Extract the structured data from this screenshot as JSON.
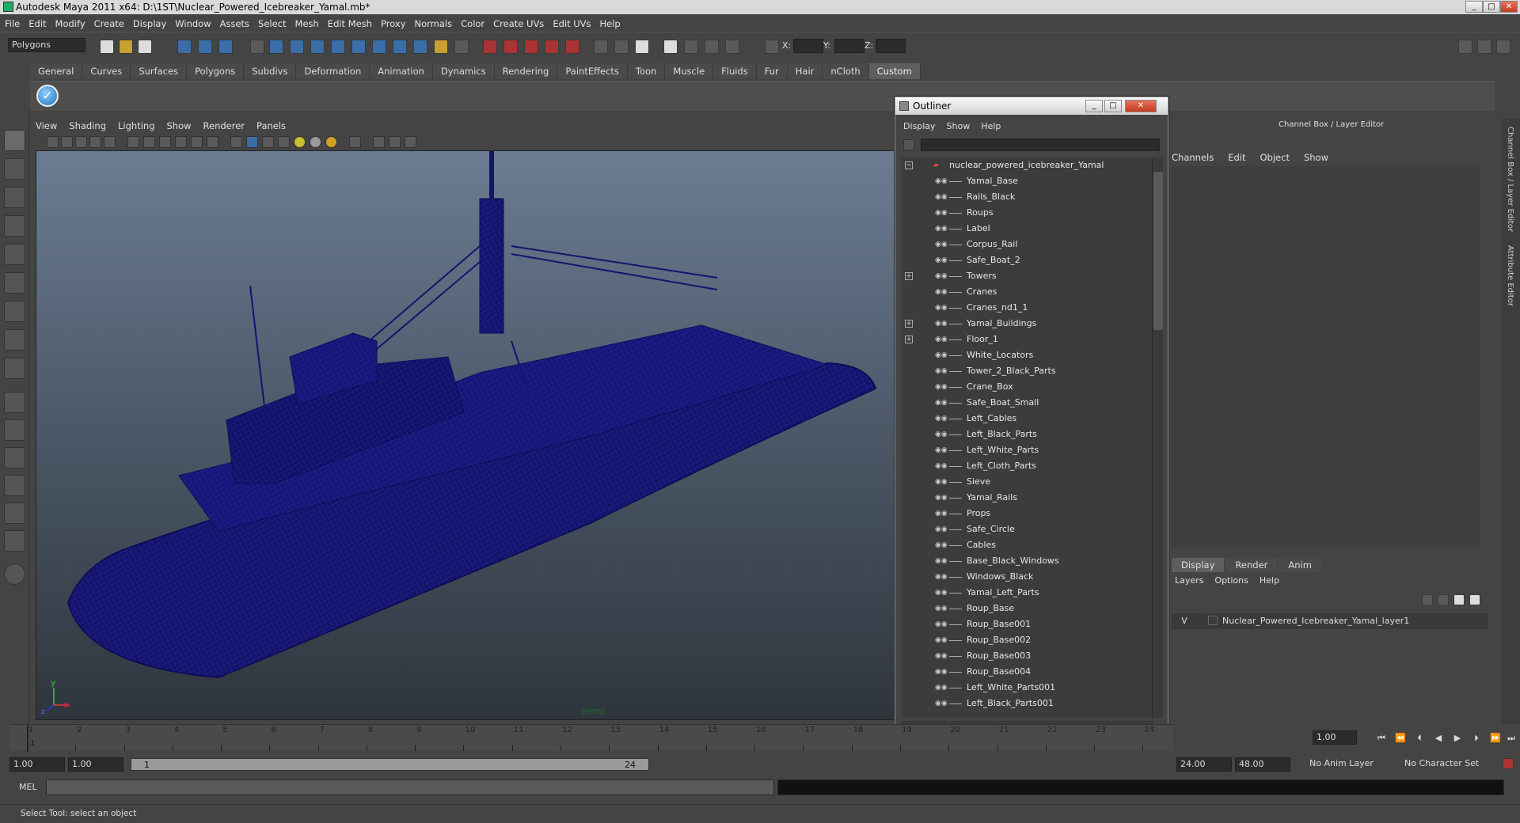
{
  "window": {
    "title": "Autodesk Maya 2011 x64: D:\\1ST\\Nuclear_Powered_Icebreaker_Yamal.mb*",
    "min": "_",
    "max": "□",
    "close": "✕"
  },
  "menubar": [
    "File",
    "Edit",
    "Modify",
    "Create",
    "Display",
    "Window",
    "Assets",
    "Select",
    "Mesh",
    "Edit Mesh",
    "Proxy",
    "Normals",
    "Color",
    "Create UVs",
    "Edit UVs",
    "Help"
  ],
  "toolbar": {
    "mode": "Polygons",
    "x_label": "X:",
    "y_label": "Y:",
    "z_label": "Z:"
  },
  "shelf": {
    "tabs": [
      "General",
      "Curves",
      "Surfaces",
      "Polygons",
      "Subdivs",
      "Deformation",
      "Animation",
      "Dynamics",
      "Rendering",
      "PaintEffects",
      "Toon",
      "Muscle",
      "Fluids",
      "Fur",
      "Hair",
      "nCloth",
      "Custom"
    ],
    "active": "Custom"
  },
  "viewport": {
    "menu": [
      "View",
      "Shading",
      "Lighting",
      "Show",
      "Renderer",
      "Panels"
    ],
    "camera_label": "persp",
    "axis_y": "y",
    "axis_x": "x",
    "axis_z": "z"
  },
  "outliner": {
    "title": "Outliner",
    "menu": [
      "Display",
      "Show",
      "Help"
    ],
    "root": "nuclear_powered_icebreaker_Yamal",
    "items": [
      {
        "label": "Yamal_Base",
        "expander": ""
      },
      {
        "label": "Rails_Black",
        "expander": ""
      },
      {
        "label": "Roups",
        "expander": ""
      },
      {
        "label": "Label",
        "expander": ""
      },
      {
        "label": "Corpus_Rail",
        "expander": ""
      },
      {
        "label": "Safe_Boat_2",
        "expander": ""
      },
      {
        "label": "Towers",
        "expander": "+"
      },
      {
        "label": "Cranes",
        "expander": ""
      },
      {
        "label": "Cranes_nd1_1",
        "expander": ""
      },
      {
        "label": "Yamal_Buildings",
        "expander": "+"
      },
      {
        "label": "Floor_1",
        "expander": "+"
      },
      {
        "label": "White_Locators",
        "expander": ""
      },
      {
        "label": "Tower_2_Black_Parts",
        "expander": ""
      },
      {
        "label": "Crane_Box",
        "expander": ""
      },
      {
        "label": "Safe_Boat_Small",
        "expander": ""
      },
      {
        "label": "Left_Cables",
        "expander": ""
      },
      {
        "label": "Left_Black_Parts",
        "expander": ""
      },
      {
        "label": "Left_White_Parts",
        "expander": ""
      },
      {
        "label": "Left_Cloth_Parts",
        "expander": ""
      },
      {
        "label": "Sieve",
        "expander": ""
      },
      {
        "label": "Yamal_Rails",
        "expander": ""
      },
      {
        "label": "Props",
        "expander": ""
      },
      {
        "label": "Safe_Circle",
        "expander": ""
      },
      {
        "label": "Cables",
        "expander": ""
      },
      {
        "label": "Base_Black_Windows",
        "expander": ""
      },
      {
        "label": "Windows_Black",
        "expander": ""
      },
      {
        "label": "Yamal_Left_Parts",
        "expander": ""
      },
      {
        "label": "Roup_Base",
        "expander": ""
      },
      {
        "label": "Roup_Base001",
        "expander": ""
      },
      {
        "label": "Roup_Base002",
        "expander": ""
      },
      {
        "label": "Roup_Base003",
        "expander": ""
      },
      {
        "label": "Roup_Base004",
        "expander": ""
      },
      {
        "label": "Left_White_Parts001",
        "expander": ""
      },
      {
        "label": "Left_Black_Parts001",
        "expander": ""
      }
    ]
  },
  "channelbox": {
    "title": "Channel Box / Layer Editor",
    "menu": [
      "Channels",
      "Edit",
      "Object",
      "Show"
    ]
  },
  "layers": {
    "tabs": [
      "Display",
      "Render",
      "Anim"
    ],
    "active": "Display",
    "menu": [
      "Layers",
      "Options",
      "Help"
    ],
    "layer_name": "Nuclear_Powered_Icebreaker_Yamal_layer1",
    "visible": "V"
  },
  "side_tabs": [
    "Channel Box / Layer Editor",
    "Attribute Editor"
  ],
  "timeline": {
    "ticks": [
      "1",
      "2",
      "3",
      "4",
      "5",
      "6",
      "7",
      "8",
      "9",
      "10",
      "11",
      "12",
      "13",
      "14",
      "15",
      "16",
      "17",
      "18",
      "19",
      "20",
      "21",
      "22",
      "23",
      "24"
    ],
    "current": "1",
    "current_box": "1.00"
  },
  "range": {
    "start": "1.00",
    "start2": "1.00",
    "range_start": "1",
    "range_end": "24",
    "end": "24.00",
    "end2": "48.00",
    "anim_layer": "No Anim Layer",
    "char_set": "No Character Set"
  },
  "mel": {
    "label": "MEL"
  },
  "status": {
    "text": "Select Tool: select an object"
  },
  "colors": {
    "wire": "#14146e",
    "accent": "#3b6ea8"
  }
}
